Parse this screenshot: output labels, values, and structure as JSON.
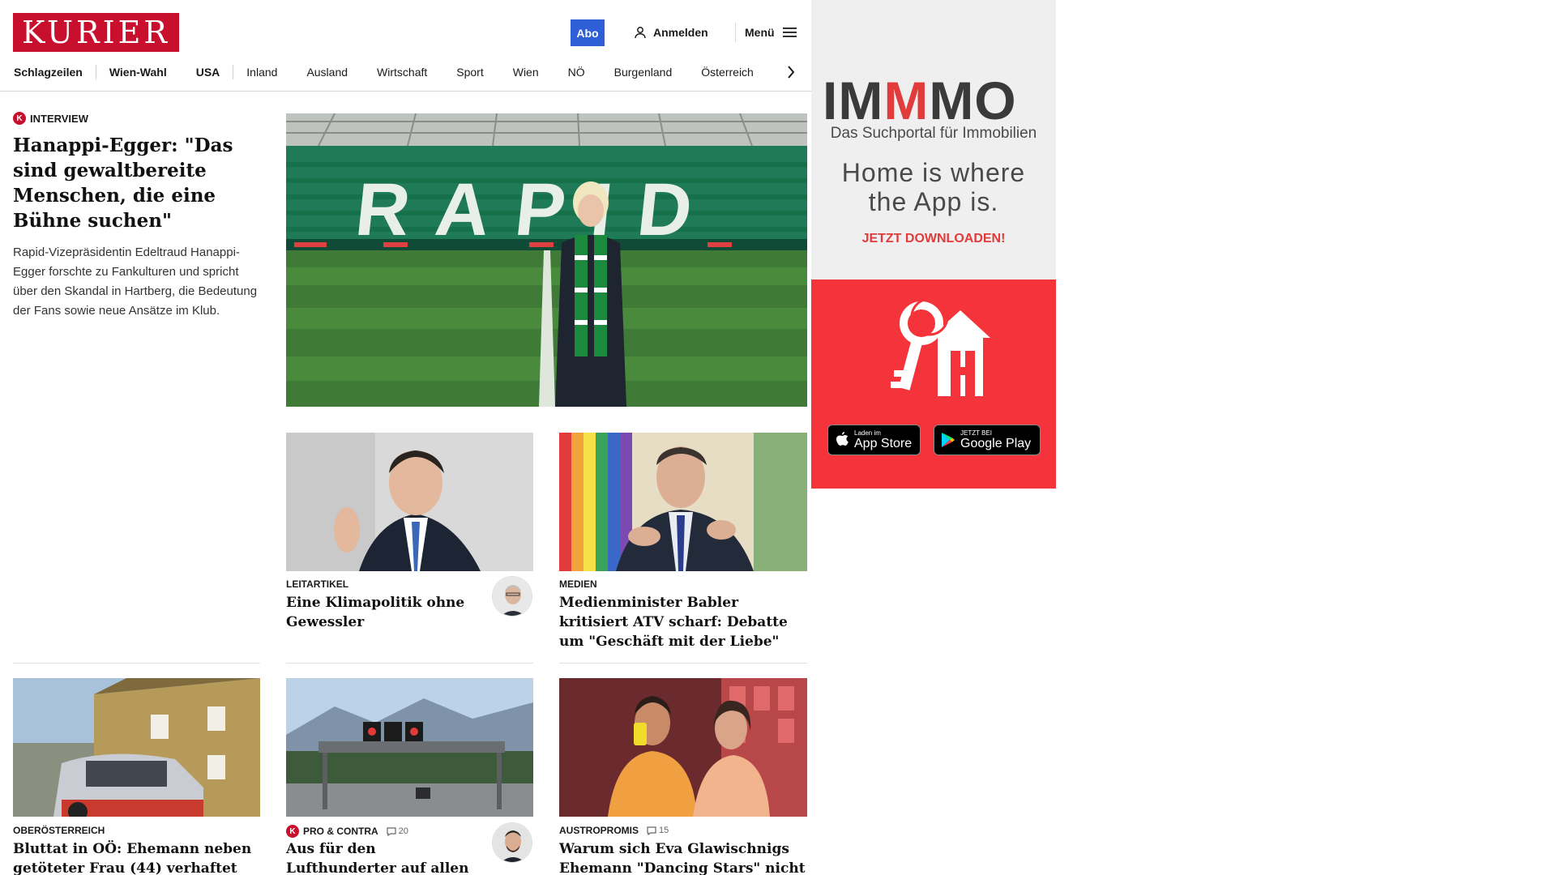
{
  "header": {
    "logo_text": "KURIER",
    "abo_label": "Abo",
    "login_label": "Anmelden",
    "menu_label": "Menü",
    "nav": [
      "Schlagzeilen",
      "Wien-Wahl",
      "USA",
      "Inland",
      "Ausland",
      "Wirtschaft",
      "Sport",
      "Wien",
      "NÖ",
      "Burgenland",
      "Österreich"
    ]
  },
  "lead": {
    "kicker_badge": "K",
    "kicker": "INTERVIEW",
    "title": "Hanappi-Egger: \"Das sind gewaltbereite Menschen, die eine Bühne suchen\"",
    "summary": "Rapid-Vizepräsidentin Edeltraud Hanappi-Egger forschte zu Fankulturen und spricht über den Skandal in Hartberg, die Bedeutung der Fans sowie neue Ansätze im Klub.",
    "stand_text": "RAPID"
  },
  "cards": [
    {
      "category": "LEITARTIKEL",
      "title": "Eine Klimapolitik ohne Gewessler"
    },
    {
      "category": "MEDIEN",
      "title": "Medienminister Babler kritisiert ATV scharf: Debatte um \"Geschäft mit der Liebe\""
    },
    {
      "category": "OBERÖSTERREICH",
      "title": "Bluttat in OÖ: Ehemann neben getöteter Frau (44) verhaftet"
    },
    {
      "badge": "K",
      "category": "PRO & CONTRA",
      "comments": "20",
      "title": "Aus für den Lufthunderter auf allen Autobahnen?"
    },
    {
      "category": "AUSTROPROMIS",
      "comments": "15",
      "title": "Warum sich Eva Glawischnigs Ehemann \"Dancing Stars\" nicht anschauen kann"
    }
  ],
  "ad": {
    "logo_pre": "IM",
    "logo_mid": "M",
    "logo_post": "MO",
    "tagline": "Das Suchportal für Immobilien",
    "slogan_line1": "Home is where",
    "slogan_line2": "the App is.",
    "cta": "JETZT DOWNLOADEN!",
    "appstore_small": "Laden im",
    "appstore_big": "App Store",
    "googleplay_small": "JETZT BEI",
    "googleplay_big": "Google Play",
    "colors": {
      "brand": "#f4333a",
      "panel": "#efefef"
    }
  },
  "colors": {
    "kurier_red": "#c8102e",
    "abo_blue": "#2f5fd6"
  }
}
